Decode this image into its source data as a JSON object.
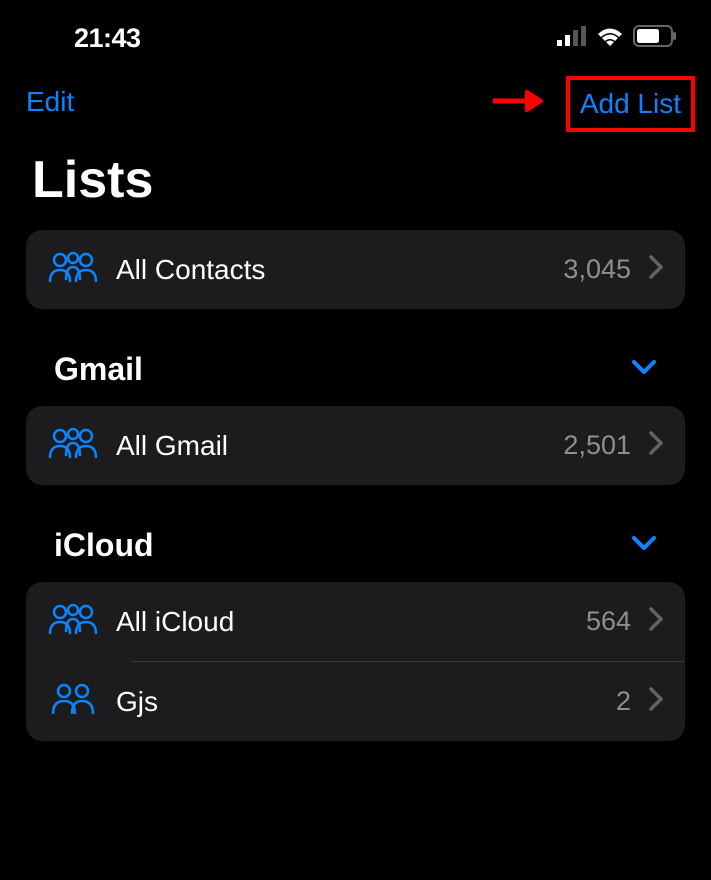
{
  "statusBar": {
    "time": "21:43"
  },
  "nav": {
    "editLabel": "Edit",
    "addListLabel": "Add List"
  },
  "pageTitle": "Lists",
  "allContacts": {
    "label": "All Contacts",
    "count": "3,045"
  },
  "sections": [
    {
      "title": "Gmail",
      "items": [
        {
          "label": "All Gmail",
          "count": "2,501",
          "iconType": "group3"
        }
      ]
    },
    {
      "title": "iCloud",
      "items": [
        {
          "label": "All iCloud",
          "count": "564",
          "iconType": "group3"
        },
        {
          "label": "Gjs",
          "count": "2",
          "iconType": "group2"
        }
      ]
    }
  ]
}
